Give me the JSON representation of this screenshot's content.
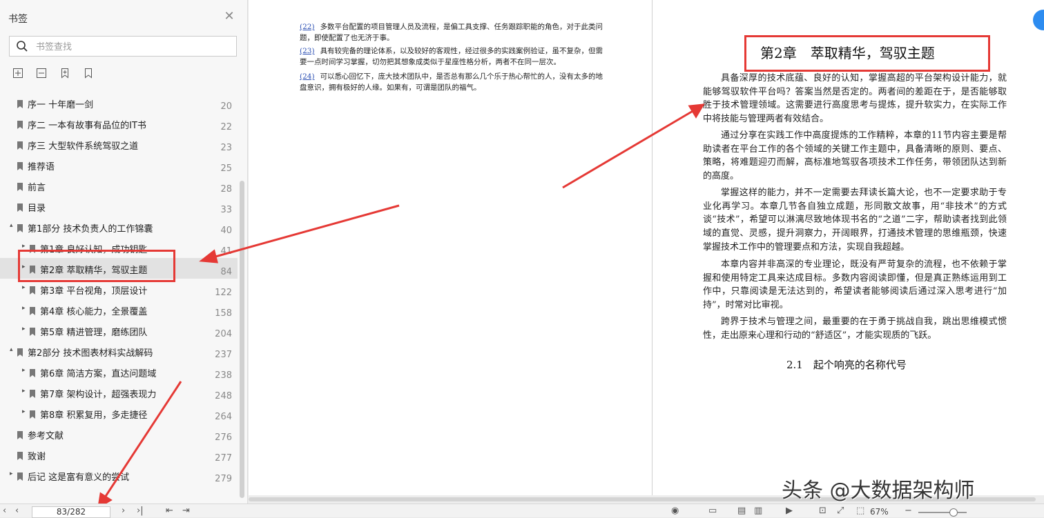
{
  "sidebar": {
    "title": "书签",
    "search_placeholder": "书签查找",
    "bookmarks": [
      {
        "label": "序一 十年磨一剑",
        "page": "20",
        "level": 0,
        "expander": "",
        "selected": false
      },
      {
        "label": "序二 一本有故事有品位的IT书",
        "page": "22",
        "level": 0,
        "expander": "",
        "selected": false
      },
      {
        "label": "序三 大型软件系统驾驭之道",
        "page": "23",
        "level": 0,
        "expander": "",
        "selected": false
      },
      {
        "label": "推荐语",
        "page": "25",
        "level": 0,
        "expander": "",
        "selected": false
      },
      {
        "label": "前言",
        "page": "28",
        "level": 0,
        "expander": "",
        "selected": false
      },
      {
        "label": "目录",
        "page": "33",
        "level": 0,
        "expander": "",
        "selected": false
      },
      {
        "label": "第1部分 技术负责人的工作锦囊",
        "page": "40",
        "level": 0,
        "expander": "▴",
        "selected": false
      },
      {
        "label": "第1章 良好认知，成功钥匙",
        "page": "41",
        "level": 1,
        "expander": "▸",
        "selected": false
      },
      {
        "label": "第2章 萃取精华，驾驭主题",
        "page": "84",
        "level": 1,
        "expander": "▸",
        "selected": true
      },
      {
        "label": "第3章 平台视角，顶层设计",
        "page": "122",
        "level": 1,
        "expander": "▸",
        "selected": false
      },
      {
        "label": "第4章 核心能力，全景覆盖",
        "page": "158",
        "level": 1,
        "expander": "▸",
        "selected": false
      },
      {
        "label": "第5章 精进管理，磨练团队",
        "page": "204",
        "level": 1,
        "expander": "▸",
        "selected": false
      },
      {
        "label": "第2部分 技术图表材料实战解码",
        "page": "237",
        "level": 0,
        "expander": "▴",
        "selected": false
      },
      {
        "label": "第6章 简洁方案，直达问题域",
        "page": "238",
        "level": 1,
        "expander": "▸",
        "selected": false
      },
      {
        "label": "第7章 架构设计，超强表现力",
        "page": "248",
        "level": 1,
        "expander": "▸",
        "selected": false
      },
      {
        "label": "第8章 积累复用，多走捷径",
        "page": "264",
        "level": 1,
        "expander": "▸",
        "selected": false
      },
      {
        "label": "参考文献",
        "page": "276",
        "level": 0,
        "expander": "",
        "selected": false
      },
      {
        "label": "致谢",
        "page": "277",
        "level": 0,
        "expander": "",
        "selected": false
      },
      {
        "label": "后记 这是富有意义的尝试",
        "page": "279",
        "level": 0,
        "expander": "▸",
        "selected": false
      }
    ]
  },
  "document": {
    "left_page": {
      "notes": [
        {
          "num": "(22)",
          "text": "多数平台配置的项目管理人员及流程，是偏工具支撑、任务跟踪职能的角色，对于此类问题，即使配置了也无济于事。"
        },
        {
          "num": "(23)",
          "text": "具有较完备的理论体系，以及较好的客观性，经过很多的实践案例验证，虽不复杂，但需要一点时间学习掌握，切勿把其想象成类似于星座性格分析，两者不在同一层次。"
        },
        {
          "num": "(24)",
          "text": "可以悉心回忆下，庞大技术团队中，是否总有那么几个乐于热心帮忙的人，没有太多的地盘意识，拥有极好的人缘。如果有，可谓是团队的福气。"
        }
      ]
    },
    "right_page": {
      "chapter_title": "第2章　萃取精华，驾驭主题",
      "paragraphs": [
        "具备深厚的技术底蕴、良好的认知，掌握高超的平台架构设计能力，就能够驾驭软件平台吗？答案当然是否定的。两者间的差距在于，是否能够取胜于技术管理领域。这需要进行高度思考与提炼，提升软实力，在实际工作中将技能与管理两者有效结合。",
        "通过分享在实践工作中高度提炼的工作精粹，本章的11节内容主要是帮助读者在平台工作的各个领域的关键工作主题中，具备清晰的原则、要点、策略，将难题迎刃而解，高标准地驾驭各项技术工作任务，带领团队达到新的高度。",
        "掌握这样的能力，并不一定需要去拜读长篇大论，也不一定要求助于专业化再学习。本章几节各自独立成题，形同散文故事，用“非技术”的方式谈“技术”，希望可以淋漓尽致地体现书名的“之道”二字，帮助读者找到此领域的直觉、灵感，提升洞察力，开阔眼界，打通技术管理的思维瓶颈，快速掌握技术工作中的管理要点和方法，实现自我超越。",
        "本章内容并非高深的专业理论，既没有严苛复杂的流程，也不依赖于掌握和使用特定工具来达成目标。多数内容阅读即懂，但是真正熟练运用到工作中，只靠阅读是无法达到的，希望读者能够阅读后通过深入思考进行“加持”，时常对比审视。",
        "跨界于技术与管理之间，最重要的在于勇于挑战自我，跳出思维模式惯性，走出原来心理和行动的“舒适区”，才能实现质的飞跃。"
      ],
      "section_title": "2.1　起个响亮的名称代号"
    },
    "watermark": "头条 @大数据架构师"
  },
  "statusbar": {
    "page_indicator": "83/282",
    "zoom": "67%",
    "zoom_level": 0.72
  },
  "colors": {
    "annotation_red": "#e53935",
    "link_blue": "#2b4fb3",
    "selected_row": "#e2e2e2"
  }
}
